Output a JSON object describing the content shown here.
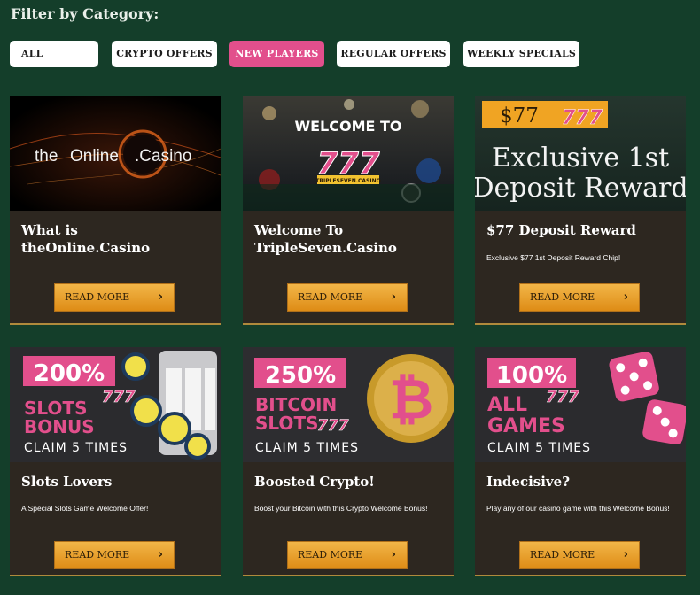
{
  "filter": {
    "title": "Filter by Category:",
    "chips": [
      "ALL",
      "CRYPTO OFFERS",
      "NEW PLAYERS",
      "REGULAR OFFERS",
      "WEEKLY SPECIALS"
    ],
    "active": "NEW PLAYERS"
  },
  "cards": [
    {
      "image_text": {
        "brand_a": "the",
        "brand_b": "Online",
        "brand_c": ".Casino"
      },
      "title": "What is theOnline.Casino",
      "description": "",
      "button": "READ MORE"
    },
    {
      "image_text": {
        "headline": "WELCOME TO",
        "logo": "777",
        "sub": "TRIPLESEVEN.CASINO"
      },
      "title": "Welcome To TripleSeven.Casino",
      "description": "",
      "button": "READ MORE"
    },
    {
      "image_text": {
        "amount": "$77",
        "logo": "777",
        "line1": "Exclusive 1st",
        "line2": "Deposit Reward"
      },
      "title": "$77 Deposit Reward",
      "description": "Exclusive $77 1st Deposit Reward Chip!",
      "button": "READ MORE"
    },
    {
      "image_text": {
        "percent": "200%",
        "logo": "777",
        "line1": "SLOTS",
        "line2": "BONUS",
        "claim": "CLAIM 5 TIMES"
      },
      "title": "Slots Lovers",
      "description": "A Special Slots Game Welcome Offer!",
      "button": "READ MORE"
    },
    {
      "image_text": {
        "percent": "250%",
        "line1": "BITCOIN",
        "line2": "SLOTS",
        "logo": "777",
        "claim": "CLAIM 5 TIMES"
      },
      "title": "Boosted Crypto!",
      "description": "Boost your Bitcoin with this Crypto Welcome Bonus!",
      "button": "READ MORE"
    },
    {
      "image_text": {
        "percent": "100%",
        "logo": "777",
        "line1": "ALL",
        "line2": "GAMES",
        "claim": "CLAIM 5 TIMES"
      },
      "title": "Indecisive?",
      "description": "Play any of our casino game with this Welcome Bonus!",
      "button": "READ MORE"
    }
  ],
  "colors": {
    "background": "#143e2a",
    "card": "#2d2720",
    "accent_pink": "#e24f8c",
    "button_orange": "#e9a02c"
  },
  "icons": {
    "button": "chevron-right-icon"
  }
}
